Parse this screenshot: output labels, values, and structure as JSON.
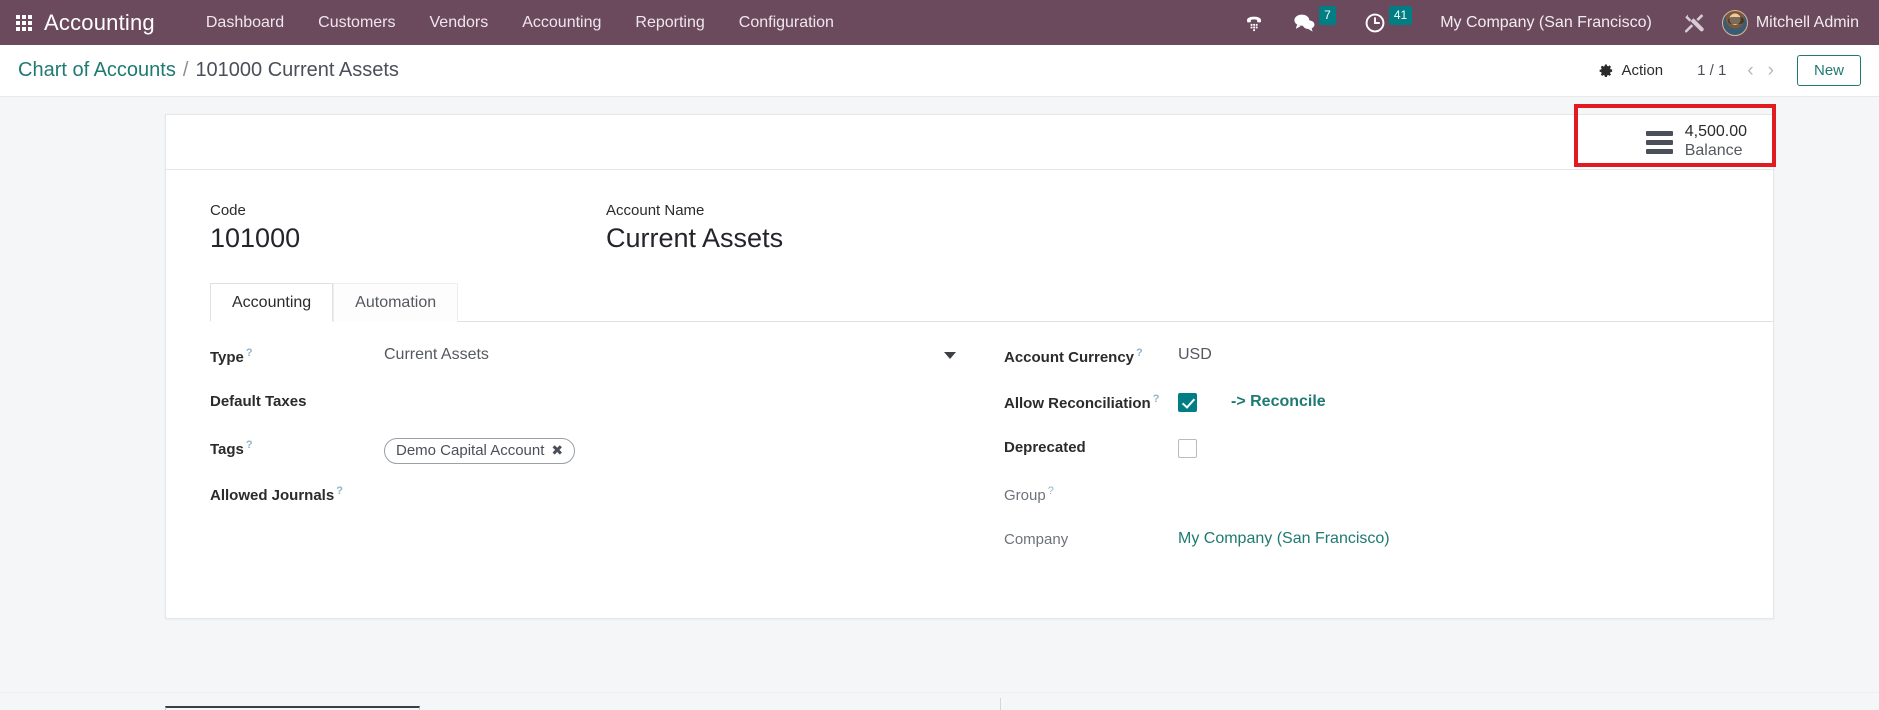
{
  "navbar": {
    "apps_icon": "apps-grid-icon",
    "brand": "Accounting",
    "menu": [
      {
        "label": "Dashboard"
      },
      {
        "label": "Customers"
      },
      {
        "label": "Vendors"
      },
      {
        "label": "Accounting"
      },
      {
        "label": "Reporting"
      },
      {
        "label": "Configuration"
      }
    ],
    "systray": {
      "voip_icon": "phone-dialpad-icon",
      "messages_icon": "chat-bubble-icon",
      "messages_count": "7",
      "activities_icon": "clock-icon",
      "activities_count": "41",
      "company": "My Company (San Francisco)",
      "debug_icon": "wrench-screwdriver-icon",
      "avatar": "user-avatar",
      "user": "Mitchell Admin"
    },
    "background": "#6b4a5d",
    "badge_color": "#017e84"
  },
  "control_panel": {
    "breadcrumb_root": "Chart of Accounts",
    "breadcrumb_separator": "/",
    "breadcrumb_current": "101000 Current Assets",
    "action_icon": "gear-icon",
    "action_label": "Action",
    "pager": "1 / 1",
    "prev_icon": "chevron-left-icon",
    "next_icon": "chevron-right-icon",
    "new_label": "New",
    "accent": "#1f7a72"
  },
  "stat_button": {
    "icon": "bars-list-icon",
    "value": "4,500.00",
    "label": "Balance",
    "highlight_color": "#e01b22"
  },
  "title": {
    "code_label": "Code",
    "code_value": "101000",
    "name_label": "Account Name",
    "name_value": "Current Assets"
  },
  "tabs": [
    {
      "label": "Accounting",
      "active": true
    },
    {
      "label": "Automation",
      "active": false
    }
  ],
  "form": {
    "left": {
      "type_label": "Type",
      "type_value": "Current Assets",
      "type_caret": "chevron-down-icon",
      "default_taxes_label": "Default Taxes",
      "default_taxes_value": "",
      "tags_label": "Tags",
      "tag_value": "Demo Capital Account",
      "tag_remove_icon": "remove-tag-icon",
      "allowed_journals_label": "Allowed Journals",
      "allowed_journals_value": ""
    },
    "right": {
      "currency_label": "Account Currency",
      "currency_value": "USD",
      "reconciliation_label": "Allow Reconciliation",
      "reconciliation_checked": true,
      "reconcile_link": "-> Reconcile",
      "deprecated_label": "Deprecated",
      "deprecated_checked": false,
      "group_label": "Group",
      "group_value": "",
      "company_label": "Company",
      "company_value": "My Company (San Francisco)"
    },
    "help_marker": "?"
  }
}
